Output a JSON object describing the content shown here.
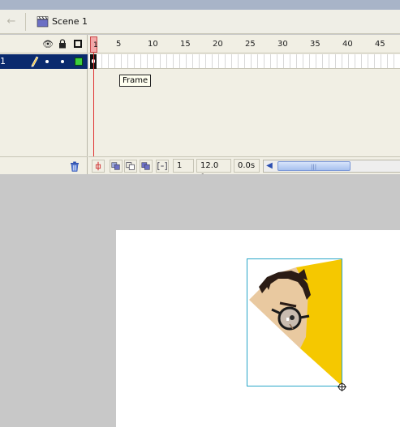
{
  "scene_bar": {
    "back_icon": "back-arrow-icon",
    "scene_icon": "clapperboard-icon",
    "scene_label": "Scene 1"
  },
  "layers": {
    "header_icons": [
      "eye-icon",
      "lock-icon",
      "outline-icon"
    ],
    "rows": [
      {
        "name": "1",
        "edit_icon": "pencil-icon",
        "color": "#3ccf3c"
      }
    ],
    "footer_icons": [
      "trash-icon"
    ]
  },
  "timeline": {
    "current_frame_marker": "1",
    "ruler_numbers": [
      "5",
      "10",
      "15",
      "20",
      "25",
      "30",
      "35",
      "40",
      "45"
    ],
    "tooltip": "Frame",
    "footer": {
      "current_frame": "1",
      "frame_rate": "12.0 fps",
      "elapsed_time": "0.0s",
      "buttons": [
        "center-frame-icon",
        "onion-skin-icon",
        "onion-skin-outlines-icon",
        "edit-multiple-frames-icon",
        "modify-onion-markers-icon"
      ]
    }
  },
  "stage": {
    "canvas_color": "#ffffff",
    "selection_color": "#29a6c8",
    "shape_fill": "#f5c800"
  }
}
